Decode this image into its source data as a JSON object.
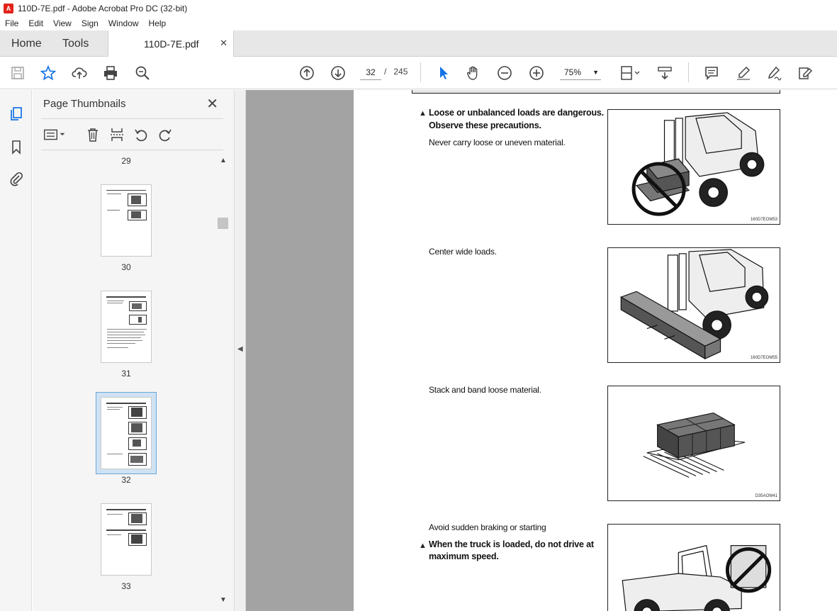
{
  "window": {
    "title": "110D-7E.pdf - Adobe Acrobat Pro DC (32-bit)"
  },
  "menu": [
    "File",
    "Edit",
    "View",
    "Sign",
    "Window",
    "Help"
  ],
  "tabs": {
    "home": "Home",
    "tools": "Tools",
    "document": "110D-7E.pdf"
  },
  "toolbar": {
    "current_page": "32",
    "page_sep": "/",
    "total_pages": "245",
    "zoom": "75%"
  },
  "panel": {
    "title": "Page Thumbnails",
    "thumbnails": [
      {
        "label": "29"
      },
      {
        "label": "30"
      },
      {
        "label": "31"
      },
      {
        "label": "32",
        "selected": true
      },
      {
        "label": "33"
      }
    ]
  },
  "document": {
    "sections": [
      {
        "heading": "Loose or unbalanced loads are  dangerous.",
        "heading2": "Observe these precautions.",
        "text": "Never carry loose or uneven material.",
        "figure_code": "160D7EOM53"
      },
      {
        "text": "Center wide loads.",
        "figure_code": "160D7EOM55"
      },
      {
        "text": "Stack and band loose material.",
        "figure_code": "D35AOM41"
      },
      {
        "text": "Avoid sudden braking or starting",
        "heading": "When the truck is loaded, do not drive at",
        "heading2": "maximum speed."
      }
    ]
  },
  "colors": {
    "accent": "#1473e6",
    "selection": "#cfe2f3",
    "gray_bg": "#a3a3a3"
  }
}
